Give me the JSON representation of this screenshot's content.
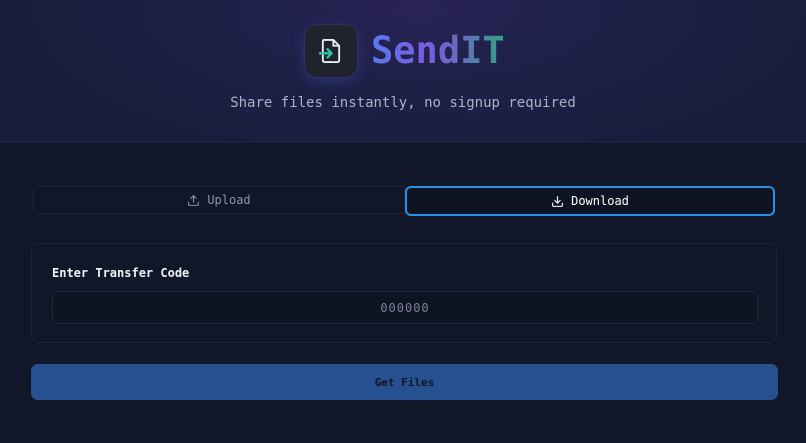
{
  "app": {
    "name": "SendIT",
    "tagline": "Share files instantly, no signup required",
    "logo_icon": "file-transfer-icon"
  },
  "tabs": [
    {
      "label": "Upload",
      "icon": "upload-icon",
      "active": false
    },
    {
      "label": "Download",
      "icon": "download-icon",
      "active": true
    }
  ],
  "download_form": {
    "field_label": "Enter Transfer Code",
    "code_value": "",
    "code_placeholder": "000000",
    "submit_label": "Get Files"
  },
  "colors": {
    "background": "#111729",
    "accent_border": "#2b8fe0",
    "primary_button": "#26508f",
    "logo_arrow": "#2ec4a6"
  }
}
